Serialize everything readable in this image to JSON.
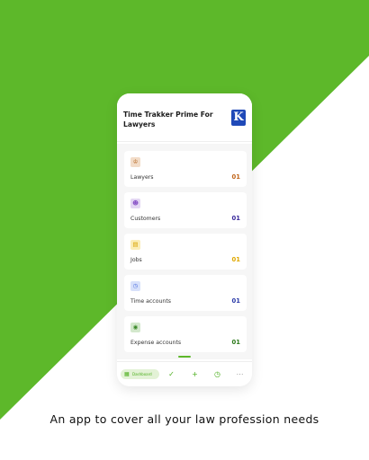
{
  "colors": {
    "brand_green": "#5db82a",
    "logo_blue": "#1f49b8"
  },
  "app": {
    "title": "Time Trakker Prime For Lawyers",
    "logo_letter": "K"
  },
  "cards": [
    {
      "label": "Lawyers",
      "count": "01",
      "icon": "lawyer-icon",
      "icon_bg": "#f2dcc8",
      "icon_color": "#b5651d",
      "count_color": "#c0651a"
    },
    {
      "label": "Customers",
      "count": "01",
      "icon": "customer-icon",
      "icon_bg": "#e3d6f3",
      "icon_color": "#8a55c8",
      "count_color": "#3a2a9c"
    },
    {
      "label": "Jobs",
      "count": "01",
      "icon": "jobs-icon",
      "icon_bg": "#fbedb8",
      "icon_color": "#d9a400",
      "count_color": "#e0a800"
    },
    {
      "label": "Time accounts",
      "count": "01",
      "icon": "time-icon",
      "icon_bg": "#d8e1fa",
      "icon_color": "#4d6fe0",
      "count_color": "#2a3aa8"
    },
    {
      "label": "Expense accounts",
      "count": "01",
      "icon": "expense-icon",
      "icon_bg": "#d3e8cc",
      "icon_color": "#3c8a2a",
      "count_color": "#2c7a1a"
    }
  ],
  "bottom_nav": {
    "dashboard_label": "Dashboard",
    "items": [
      "dashboard-icon",
      "check-icon",
      "plus-icon",
      "clock-icon",
      "more-icon"
    ]
  },
  "tagline": "An app to cover all your law profession needs"
}
